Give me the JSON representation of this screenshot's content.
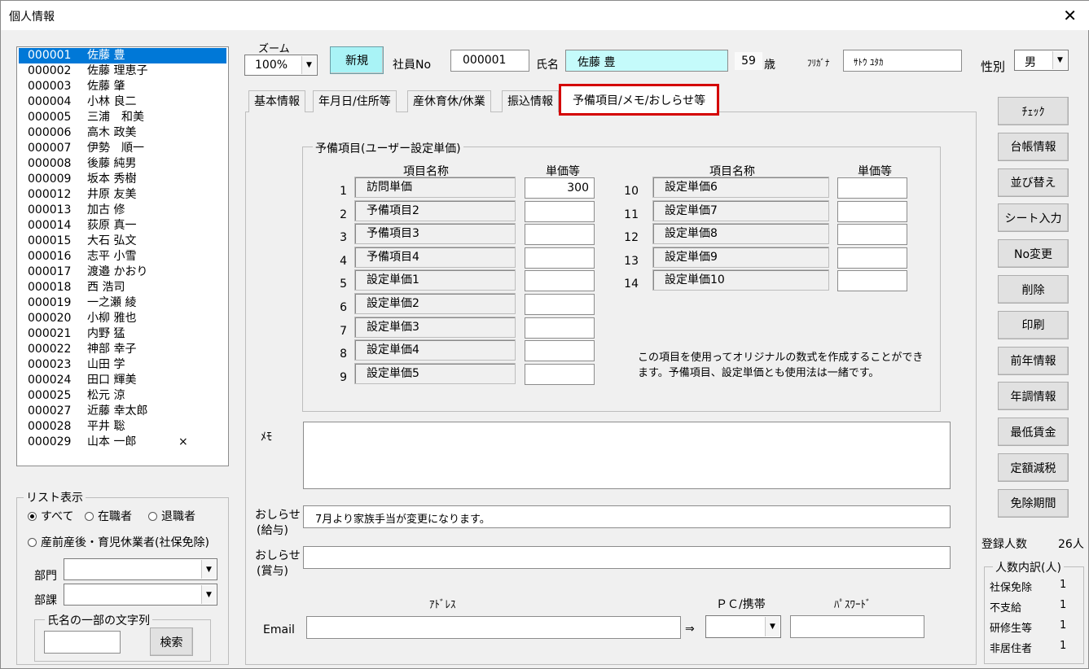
{
  "window": {
    "title": "個人情報",
    "close_label": "✕"
  },
  "employees": [
    {
      "code": "000001",
      "name": "佐藤 豊",
      "selected": true,
      "mark": ""
    },
    {
      "code": "000002",
      "name": "佐藤 理恵子",
      "mark": ""
    },
    {
      "code": "000003",
      "name": "佐藤 肇",
      "mark": ""
    },
    {
      "code": "000004",
      "name": "小林 良二",
      "mark": ""
    },
    {
      "code": "000005",
      "name": "三浦　和美",
      "mark": ""
    },
    {
      "code": "000006",
      "name": "高木 政美",
      "mark": ""
    },
    {
      "code": "000007",
      "name": "伊勢　順一",
      "mark": ""
    },
    {
      "code": "000008",
      "name": "後藤 純男",
      "mark": ""
    },
    {
      "code": "000009",
      "name": "坂本 秀樹",
      "mark": ""
    },
    {
      "code": "000012",
      "name": "井原 友美",
      "mark": ""
    },
    {
      "code": "000013",
      "name": "加古 修",
      "mark": ""
    },
    {
      "code": "000014",
      "name": "荻原 真一",
      "mark": ""
    },
    {
      "code": "000015",
      "name": "大石 弘文",
      "mark": ""
    },
    {
      "code": "000016",
      "name": "志平 小雪",
      "mark": ""
    },
    {
      "code": "000017",
      "name": "渡邉 かおり",
      "mark": ""
    },
    {
      "code": "000018",
      "name": "西 浩司",
      "mark": ""
    },
    {
      "code": "000019",
      "name": "一之瀬 綾",
      "mark": ""
    },
    {
      "code": "000020",
      "name": "小柳 雅也",
      "mark": ""
    },
    {
      "code": "000021",
      "name": "内野 猛",
      "mark": ""
    },
    {
      "code": "000022",
      "name": "神部 幸子",
      "mark": ""
    },
    {
      "code": "000023",
      "name": "山田 学",
      "mark": ""
    },
    {
      "code": "000024",
      "name": "田口 輝美",
      "mark": ""
    },
    {
      "code": "000025",
      "name": "松元 涼",
      "mark": ""
    },
    {
      "code": "000027",
      "name": "近藤 幸太郎",
      "mark": ""
    },
    {
      "code": "000028",
      "name": "平井 聡",
      "mark": ""
    },
    {
      "code": "000029",
      "name": "山本 一郎",
      "mark": "×"
    }
  ],
  "list_display": {
    "group_label": "リスト表示",
    "options": [
      "すべて",
      "在職者",
      "退職者"
    ],
    "option_leave": "産前産後・育児休業者(社保免除)",
    "selected": "すべて",
    "dept_label": "部門",
    "section_label": "部課",
    "dept_value": "",
    "section_value": "",
    "name_search_label": "氏名の一部の文字列",
    "name_search_value": "",
    "search_button": "検索"
  },
  "header": {
    "zoom_label": "ズーム",
    "zoom_value": "100%",
    "new_button": "新規",
    "employee_no_label": "社員No",
    "employee_no": "000001",
    "name_label": "氏名",
    "name_value": "佐藤 豊",
    "age_value": "59",
    "age_unit": "歳",
    "furigana_label": "ﾌﾘｶﾞﾅ",
    "furigana_value": "ｻﾄｳ ﾕﾀｶ",
    "gender_label": "性別",
    "gender_value": "男"
  },
  "tabs": [
    {
      "label": "基本情報"
    },
    {
      "label": "年月日/住所等"
    },
    {
      "label": "産休育休/休業"
    },
    {
      "label": "振込情報"
    },
    {
      "label": "予備項目/メモ/おしらせ等",
      "active": true
    }
  ],
  "reserve": {
    "group_label": "予備項目(ユーザー設定単価)",
    "col_name": "項目名称",
    "col_unit": "単価等",
    "left_rows": [
      {
        "no": "1",
        "name": "訪問単価",
        "value": "300"
      },
      {
        "no": "2",
        "name": "予備項目2",
        "value": ""
      },
      {
        "no": "3",
        "name": "予備項目3",
        "value": ""
      },
      {
        "no": "4",
        "name": "予備項目4",
        "value": ""
      },
      {
        "no": "5",
        "name": "設定単価1",
        "value": ""
      },
      {
        "no": "6",
        "name": "設定単価2",
        "value": ""
      },
      {
        "no": "7",
        "name": "設定単価3",
        "value": ""
      },
      {
        "no": "8",
        "name": "設定単価4",
        "value": ""
      },
      {
        "no": "9",
        "name": "設定単価5",
        "value": ""
      }
    ],
    "right_rows": [
      {
        "no": "10",
        "name": "設定単価6",
        "value": ""
      },
      {
        "no": "11",
        "name": "設定単価7",
        "value": ""
      },
      {
        "no": "12",
        "name": "設定単価8",
        "value": ""
      },
      {
        "no": "13",
        "name": "設定単価9",
        "value": ""
      },
      {
        "no": "14",
        "name": "設定単価10",
        "value": ""
      }
    ],
    "note_line1": "この項目を使用ってオリジナルの数式を作成することができ",
    "note_line2": "ます。予備項目、設定単価とも使用法は一緒です。"
  },
  "memo": {
    "label": "ﾒﾓ",
    "value": ""
  },
  "notice_salary": {
    "label1": "おしらせ",
    "label2": "(給与)",
    "value": "7月より家族手当が変更になります。"
  },
  "notice_bonus": {
    "label1": "おしらせ",
    "label2": "(賞与)",
    "value": ""
  },
  "email": {
    "label": "Email",
    "address_label": "ｱﾄﾞﾚｽ",
    "address_value": "",
    "arrow": "⇒",
    "device_label": "ＰＣ/携帯",
    "device_value": "",
    "password_label": "ﾊﾟｽﾜｰﾄﾞ",
    "password_value": ""
  },
  "side_buttons": [
    "ﾁｪｯｸ",
    "台帳情報",
    "並び替え",
    "シート入力",
    "No変更",
    "削除",
    "印刷",
    "前年情報",
    "年調情報",
    "最低賃金",
    "定額減税",
    "免除期間"
  ],
  "stats": {
    "registered_label": "登録人数",
    "registered_value": "26人",
    "breakdown_label": "人数内訳(人)",
    "rows": [
      {
        "label": "社保免除",
        "value": "1"
      },
      {
        "label": "不支給",
        "value": "1"
      },
      {
        "label": "研修生等",
        "value": "1"
      },
      {
        "label": "非居住者",
        "value": "1"
      }
    ]
  }
}
